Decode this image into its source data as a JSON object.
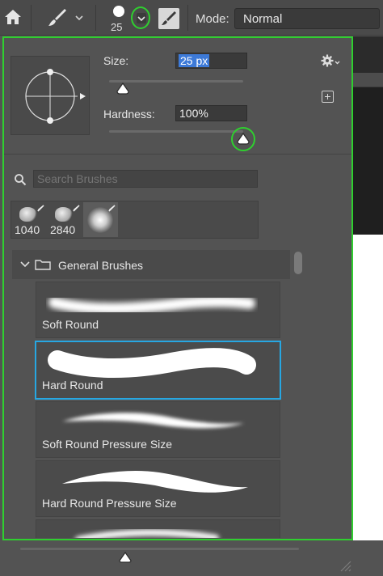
{
  "toolbar": {
    "brush_size": "25",
    "mode_label": "Mode:",
    "mode_value": "Normal"
  },
  "panel": {
    "size_label": "Size:",
    "size_value": "25 px",
    "hardness_label": "Hardness:",
    "hardness_value": "100%",
    "search_placeholder": "Search Brushes",
    "recent_brushes": [
      {
        "number": "1040",
        "selected": false
      },
      {
        "number": "2840",
        "selected": false
      },
      {
        "number": "",
        "selected": true
      }
    ],
    "group_name": "General Brushes",
    "brushes": [
      {
        "name": "Soft Round",
        "selected": false
      },
      {
        "name": "Hard Round",
        "selected": true
      },
      {
        "name": "Soft Round Pressure Size",
        "selected": false
      },
      {
        "name": "Hard Round Pressure Size",
        "selected": false
      },
      {
        "name": "",
        "selected": false
      }
    ]
  },
  "colors": {
    "highlight_ring": "#2fcf2f",
    "selection_border": "#27a7e2",
    "text_selection": "#3d7ad8"
  },
  "icons": [
    "home-icon",
    "brush-tool-icon",
    "chevron-down-icon",
    "brush-preset-picker-icon",
    "airbrush-icon",
    "gear-icon",
    "new-preset-icon",
    "search-icon",
    "folder-icon",
    "resize-grip-icon"
  ]
}
